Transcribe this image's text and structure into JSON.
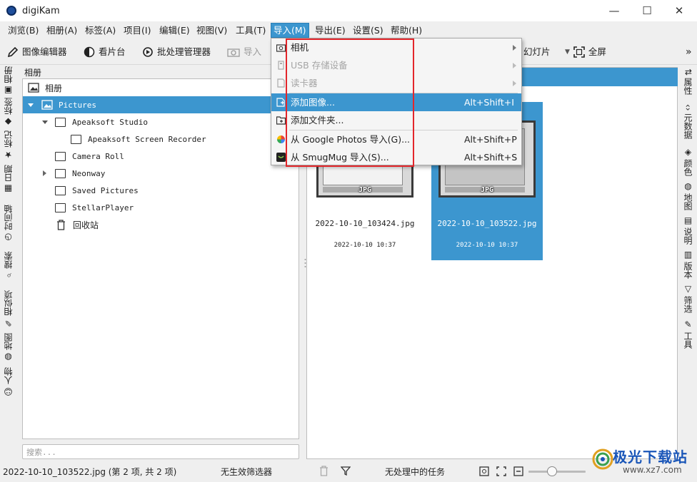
{
  "window": {
    "title": "digiKam",
    "min": "—",
    "max": "☐",
    "close": "✕"
  },
  "menubar": [
    {
      "label": "浏览(B)"
    },
    {
      "label": "相册(A)"
    },
    {
      "label": "标签(A)"
    },
    {
      "label": "项目(I)"
    },
    {
      "label": "编辑(E)"
    },
    {
      "label": "视图(V)"
    },
    {
      "label": "工具(T)"
    },
    {
      "label": "导入(M)"
    },
    {
      "label": "导出(E)"
    },
    {
      "label": "设置(S)"
    },
    {
      "label": "帮助(H)"
    }
  ],
  "toolbar": {
    "image_editor": "图像编辑器",
    "light_table": "看片台",
    "batch_queue": "批处理管理器",
    "import": "导入",
    "slideshow": "幻灯片",
    "fullscreen": "全屏",
    "more": "»"
  },
  "left_tabs": [
    "相册",
    "标签",
    "标记",
    "日期",
    "时间轴",
    "搜索",
    "相似项",
    "地图",
    "人物"
  ],
  "right_tabs": [
    "属性",
    "元数据",
    "颜色",
    "地图",
    "说明",
    "版本",
    "筛选",
    "工具"
  ],
  "albums": {
    "header": "相册",
    "root": "相册",
    "items": [
      {
        "label": "Pictures"
      },
      {
        "label": "Apeaksoft Studio"
      },
      {
        "label": "Apeaksoft Screen Recorder"
      },
      {
        "label": "Camera Roll"
      },
      {
        "label": "Neonway"
      },
      {
        "label": "Saved Pictures"
      },
      {
        "label": "StellarPlayer"
      },
      {
        "label": "回收站"
      }
    ],
    "search_placeholder": "搜索..."
  },
  "thumbnails": [
    {
      "name": "2022-10-10_103424.jpg",
      "date": "2022-10-10 10:37",
      "badge": "JPG",
      "selected": false
    },
    {
      "name": "2022-10-10_103522.jpg",
      "date": "2022-10-10 10:37",
      "badge": "JPG",
      "selected": true
    }
  ],
  "import_menu": {
    "items": [
      {
        "label": "相机",
        "shortcut": "",
        "disabled": false,
        "submenu": true
      },
      {
        "label": "USB 存储设备",
        "shortcut": "",
        "disabled": true,
        "submenu": true
      },
      {
        "label": "读卡器",
        "shortcut": "",
        "disabled": true,
        "submenu": true
      },
      {
        "label": "添加图像...",
        "shortcut": "Alt+Shift+I",
        "disabled": false,
        "highlighted": true
      },
      {
        "label": "添加文件夹...",
        "shortcut": "",
        "disabled": false
      },
      {
        "label": "从 Google Photos 导入(G)...",
        "shortcut": "Alt+Shift+P",
        "disabled": false
      },
      {
        "label": "从 SmugMug 导入(S)...",
        "shortcut": "Alt+Shift+S",
        "disabled": false
      }
    ]
  },
  "status": {
    "selection": "2022-10-10_103522.jpg (第 2 项, 共 2 项)",
    "filter": "无生效筛选器",
    "tasks": "无处理中的任务"
  },
  "watermark": {
    "text": "极光下载站",
    "url": "www.xz7.com"
  },
  "colors": {
    "accent": "#3c96cf",
    "highlight_box": "#e3262b"
  }
}
